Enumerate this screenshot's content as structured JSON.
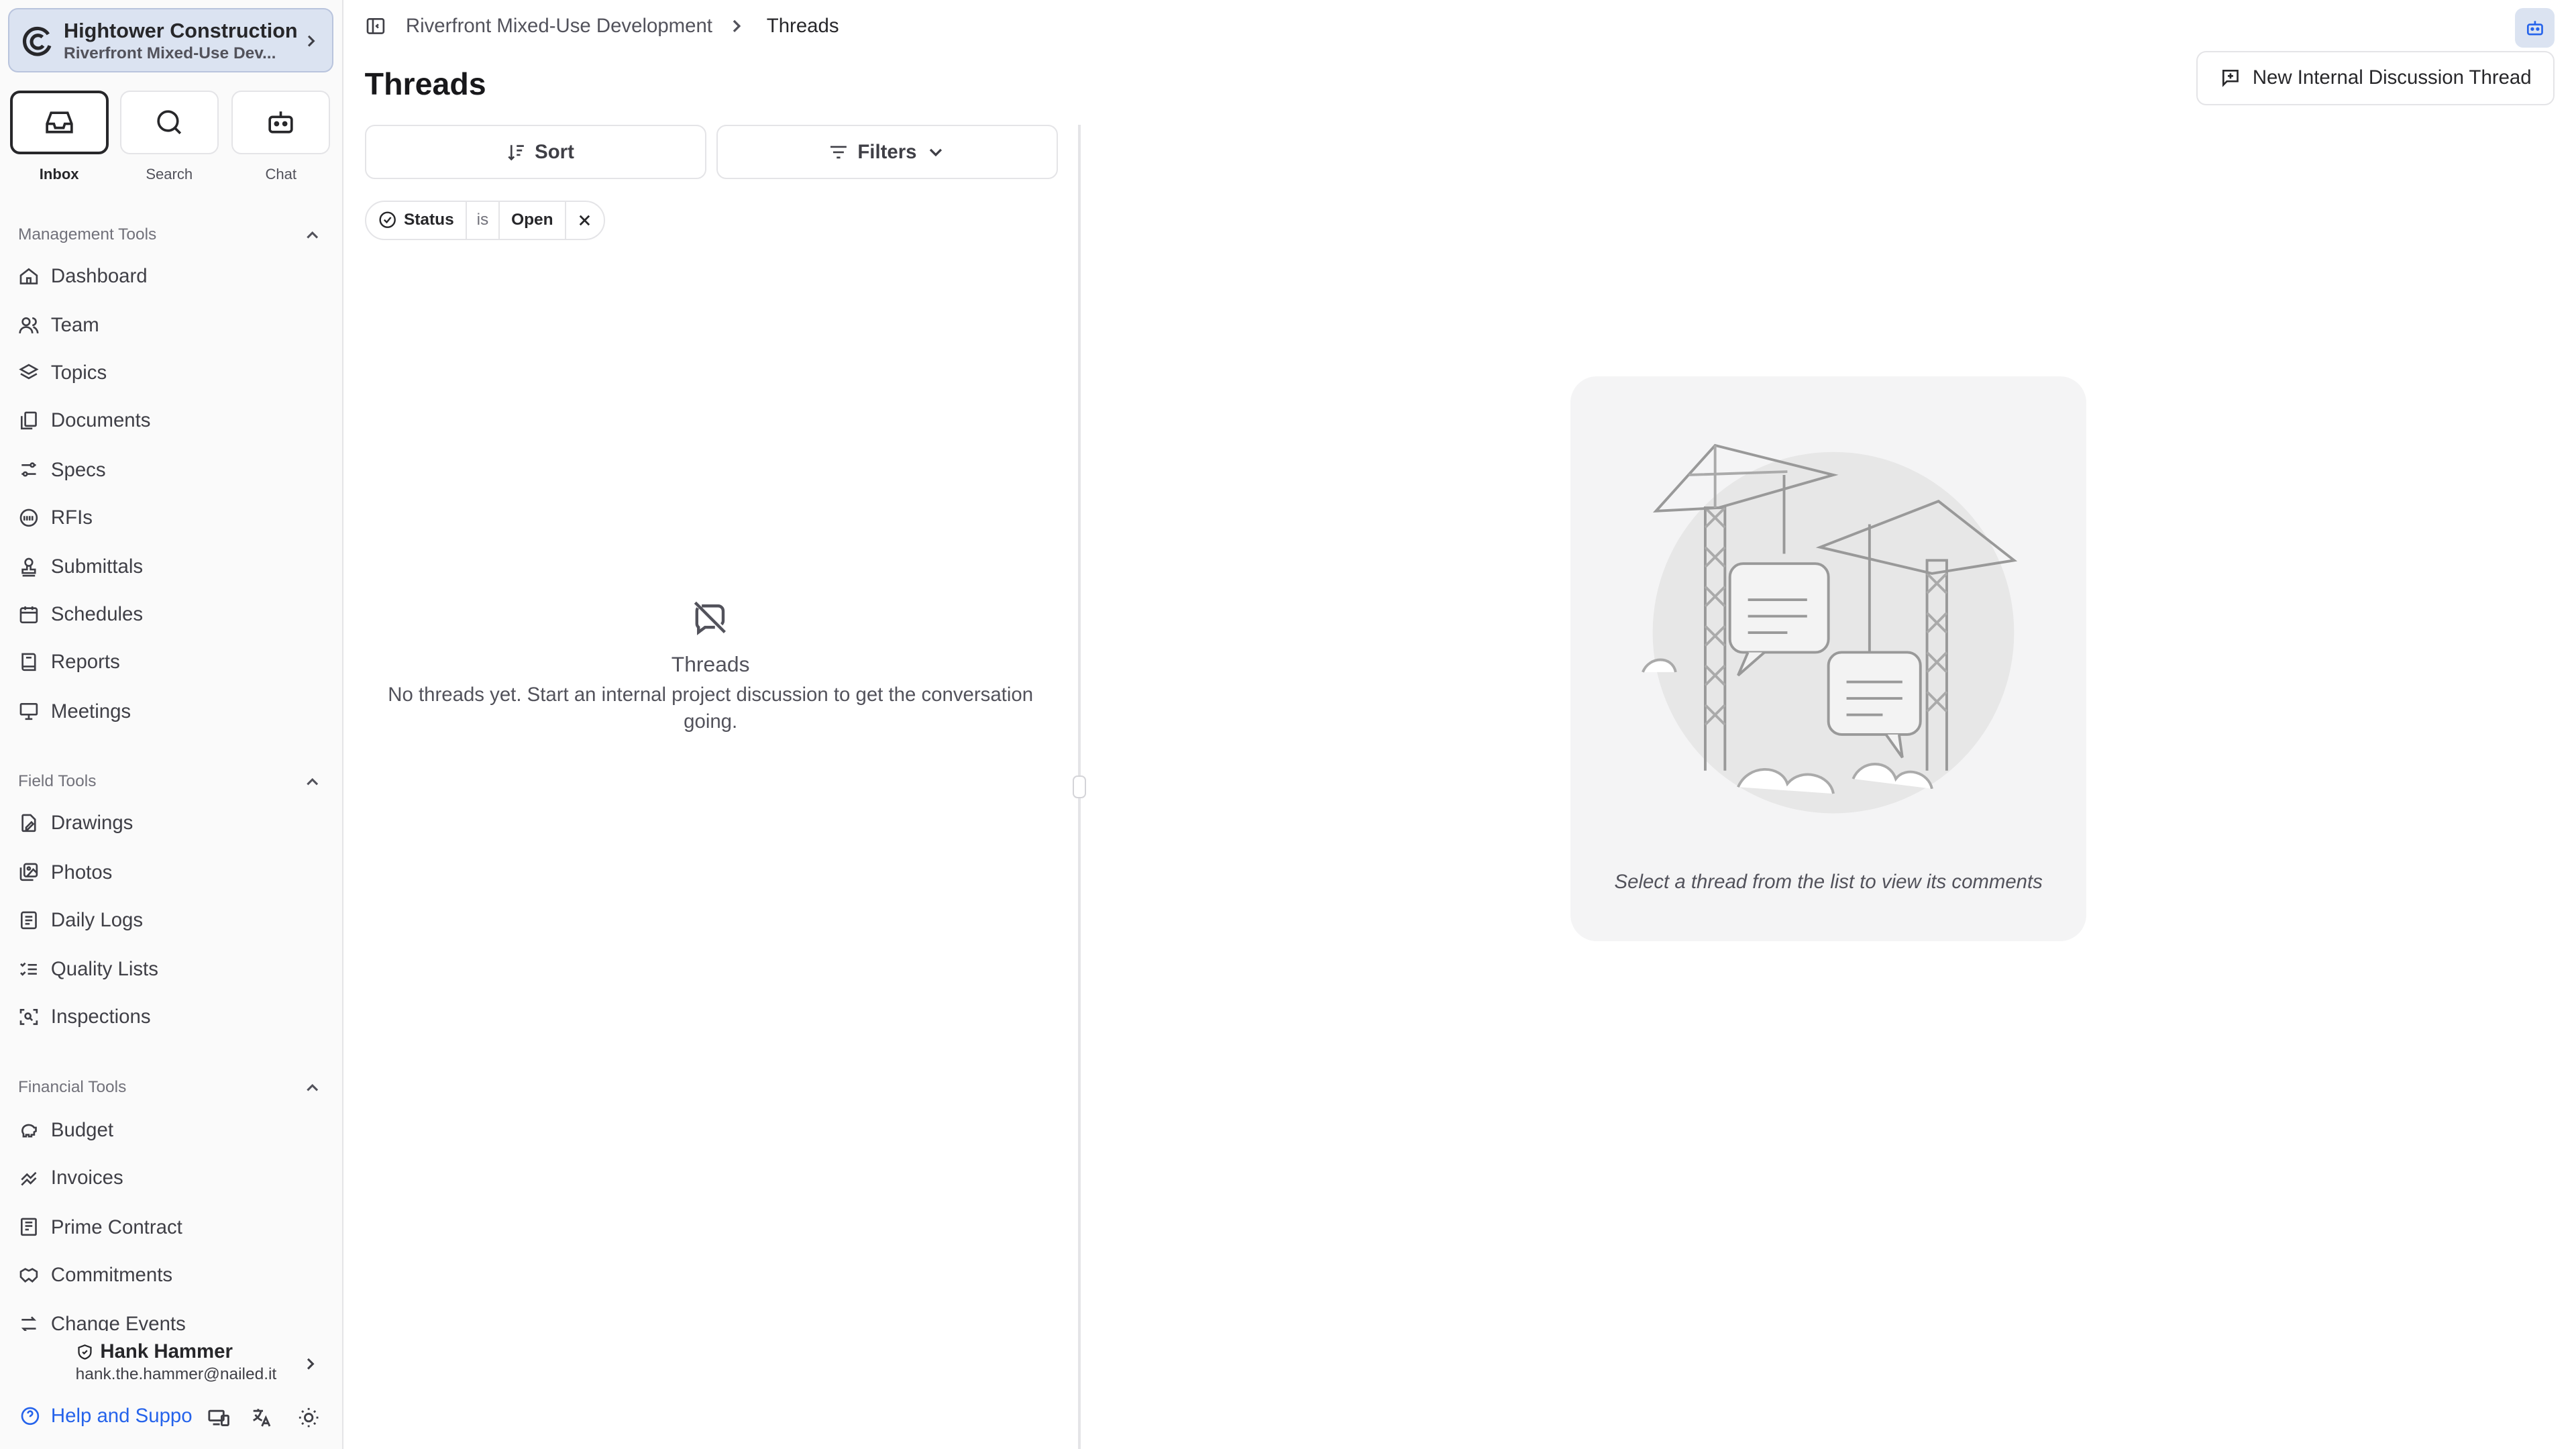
{
  "org": {
    "name": "Hightower Construction",
    "project": "Riverfront Mixed-Use Dev..."
  },
  "quick_actions": [
    {
      "label": "Inbox"
    },
    {
      "label": "Search"
    },
    {
      "label": "Chat"
    }
  ],
  "sections": {
    "management": {
      "title": "Management Tools",
      "items": [
        "Dashboard",
        "Team",
        "Topics",
        "Documents",
        "Specs",
        "RFIs",
        "Submittals",
        "Schedules",
        "Reports",
        "Meetings"
      ]
    },
    "field": {
      "title": "Field Tools",
      "items": [
        "Drawings",
        "Photos",
        "Daily Logs",
        "Quality Lists",
        "Inspections"
      ]
    },
    "financial": {
      "title": "Financial Tools",
      "items": [
        "Budget",
        "Invoices",
        "Prime Contract",
        "Commitments",
        "Change Events"
      ]
    }
  },
  "user": {
    "name": "Hank Hammer",
    "email": "hank.the.hammer@nailed.it"
  },
  "help_label": "Help and Suppo",
  "breadcrumb": {
    "project": "Riverfront Mixed-Use Development",
    "current": "Threads"
  },
  "page_title": "Threads",
  "new_thread_label": "New Internal Discussion Thread",
  "toolbar": {
    "sort_label": "Sort",
    "filters_label": "Filters"
  },
  "filter_chip": {
    "field": "Status",
    "op": "is",
    "value": "Open"
  },
  "empty": {
    "title": "Threads",
    "text": "No threads yet. Start an internal project discussion to get the conversation going."
  },
  "placeholder_text": "Select a thread from the list to view its comments",
  "colors": {
    "accent": "#2563eb",
    "org_bg": "#dbe3f1",
    "sidebar_bg": "#fafafa"
  }
}
